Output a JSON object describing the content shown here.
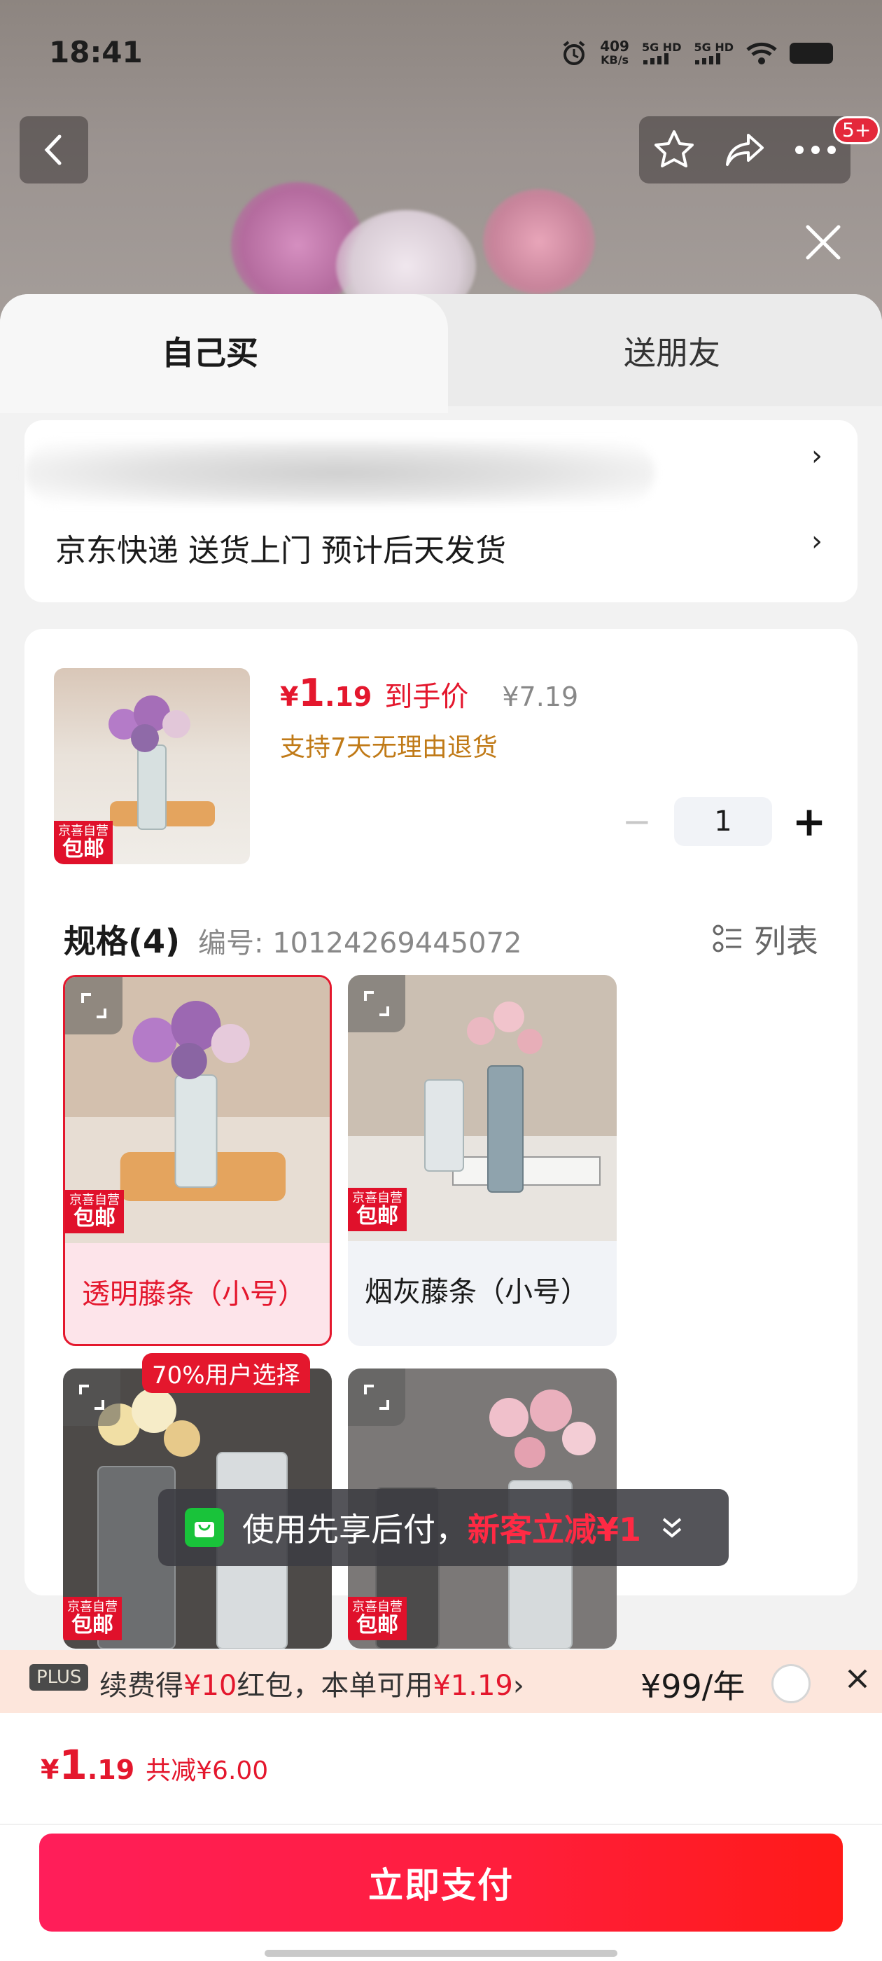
{
  "status_bar": {
    "time": "18:41",
    "net_speed_value": "409",
    "net_speed_unit": "KB/s",
    "signal_1": "5G HD",
    "signal_2": "5G HD"
  },
  "nav": {
    "notification_badge": "5+"
  },
  "tabs": {
    "self_buy": "自己买",
    "gift_friend": "送朋友"
  },
  "address": {
    "shipping_text": "京东快递 送货上门 预计后天发货"
  },
  "product": {
    "currency": "¥",
    "price_int": "1",
    "price_dec": ".19",
    "price_label": "到手价",
    "original_price": "¥7.19",
    "return_policy": "支持7天无理由退货",
    "quantity": "1",
    "tag_top": "京喜自营",
    "tag_bottom": "包邮"
  },
  "spec": {
    "title": "规格(4)",
    "code": "编号: 10124269445072",
    "list_label": "列表"
  },
  "variants": [
    {
      "label": "透明藤条（小号）",
      "selected": true
    },
    {
      "label": "烟灰藤条（小号）",
      "selected": false
    },
    {
      "label": "",
      "selected": false
    },
    {
      "label": "",
      "selected": false
    }
  ],
  "choose_badge": "70%用户选择",
  "toast": {
    "text": "使用先享后付，",
    "highlight": "新客立减¥1"
  },
  "plus_bar": {
    "label": "PLUS",
    "text_pre": "续费得",
    "red1": "¥10",
    "text_mid": "红包，本单可用",
    "red2": "¥1.19",
    "arrow": "›",
    "price": "¥99/年"
  },
  "bottom": {
    "currency": "¥",
    "total_int": "1",
    "total_dec": ".19",
    "saved": "共减¥6.00",
    "pay_button": "立即支付"
  },
  "colors": {
    "brand_red": "#e4172d",
    "orange_text": "#c07a17",
    "tag_red": "#e0112b"
  }
}
